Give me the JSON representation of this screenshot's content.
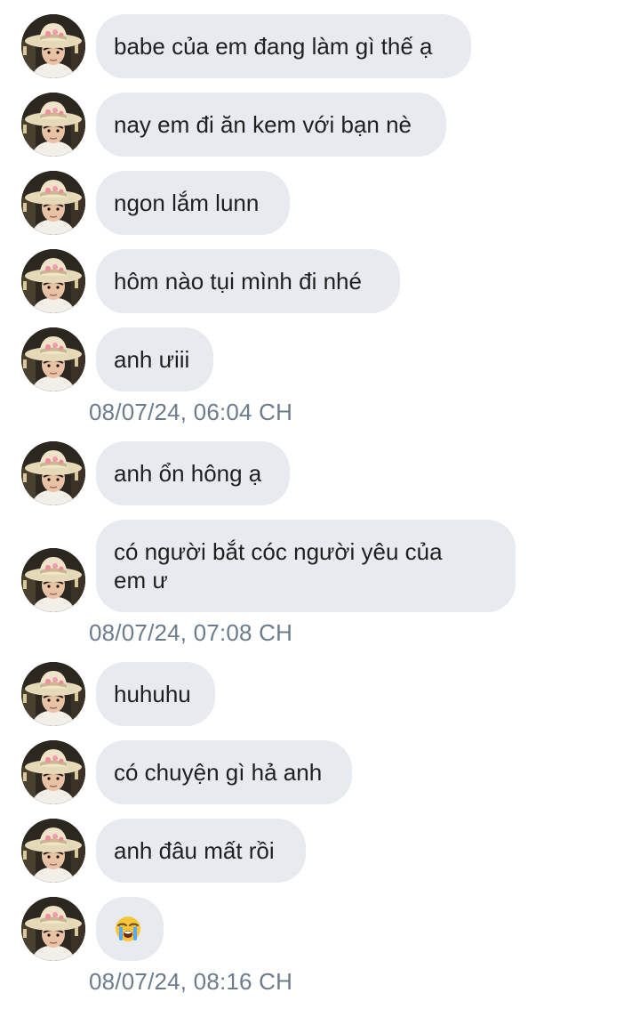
{
  "messages": [
    {
      "text": "babe của em đang làm gì thế ạ"
    },
    {
      "text": "nay em đi ăn kem với bạn nè"
    },
    {
      "text": "ngon lắm lunn"
    },
    {
      "text": "hôm nào tụi mình đi nhé"
    },
    {
      "text": "anh ưiii"
    },
    {
      "text": "anh ổn hông ạ"
    },
    {
      "text": "có người bắt cóc người yêu của\nem ư"
    },
    {
      "text": "huhuhu"
    },
    {
      "text": "có chuyện gì hả anh"
    },
    {
      "text": "anh đâu mất rồi"
    },
    {
      "emoji": "loudly-crying-face"
    }
  ],
  "timestamps": [
    "08/07/24, 06:04 CH",
    "08/07/24, 07:08 CH",
    "08/07/24, 08:16 CH"
  ],
  "colors": {
    "bubble_bg": "#e7ebf0",
    "text": "#1f1f1f",
    "timestamp": "#6c7c8c",
    "background": "#ffffff"
  }
}
